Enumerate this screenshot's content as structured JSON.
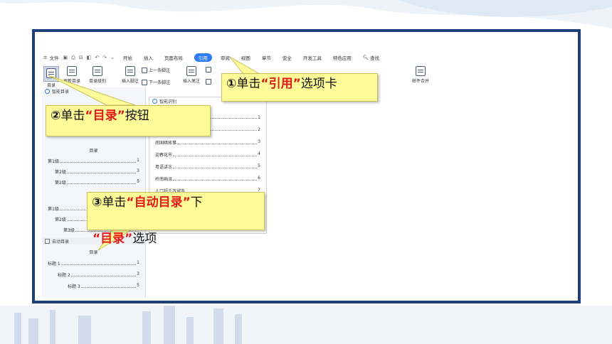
{
  "theme": {
    "frame_color": "#1e3f7a",
    "active_tab_color": "#2e7cf6",
    "callout_color": "#fffb98",
    "highlight_color": "#e21a1a"
  },
  "menu": {
    "label": "文件"
  },
  "tabs": [
    "开始",
    "插入",
    "页面布局",
    "引用",
    "审阅",
    "视图",
    "章节",
    "安全",
    "开发工具",
    "特色应用"
  ],
  "search_label": "查找",
  "ribbon": {
    "toc": "目录",
    "update_toc": "更新目录",
    "toc_level": "目录级别",
    "insert_footnote": "插入脚注",
    "prev_footnote": "上一条脚注",
    "next_footnote": "下一条脚注",
    "insert_endnote": "插入尾注",
    "mail_merge": "邮件合并"
  },
  "pane1": {
    "title": "智能目录",
    "toc_title": "目录",
    "entries_a": [
      {
        "label": "第1级",
        "page": "1"
      },
      {
        "label": "第2级",
        "page": "3"
      },
      {
        "label": "第2级",
        "page": "5"
      }
    ],
    "entries_b": [
      {
        "label": "第1级",
        "page": ""
      },
      {
        "label": "第2级",
        "page": ""
      },
      {
        "label": "第3级",
        "page": ""
      }
    ],
    "auto_title": "自动目录",
    "auto_toc_title": "目录",
    "auto_entries": [
      {
        "label": "标题 1",
        "page": "1"
      },
      {
        "label": "标题 2",
        "page": "3"
      },
      {
        "label": "标题 3",
        "page": "5"
      }
    ]
  },
  "pane2": {
    "title": "智能识别",
    "entries": [
      {
        "label": "",
        "page": "1"
      },
      {
        "label": "",
        "page": "2"
      },
      {
        "label": "南国暗故事",
        "page": "3"
      },
      {
        "label": "迎春花市",
        "page": "4"
      },
      {
        "label": "粤语讲古",
        "page": "5"
      },
      {
        "label": "岭南画派",
        "page": "6"
      },
      {
        "label": "人口超千万城市",
        "page": "7"
      }
    ]
  },
  "callouts": {
    "c1": {
      "num": "①",
      "pre": "单击",
      "hl": "“引用”",
      "post": "选项卡"
    },
    "c2": {
      "num": "②",
      "pre": "单击",
      "hl": "“目录”",
      "post": "按钮"
    },
    "c3": {
      "num": "③",
      "pre": "单击",
      "hl": "“自动目录”",
      "mid": "下",
      "hl2": "“目录”",
      "post": "选项"
    }
  }
}
